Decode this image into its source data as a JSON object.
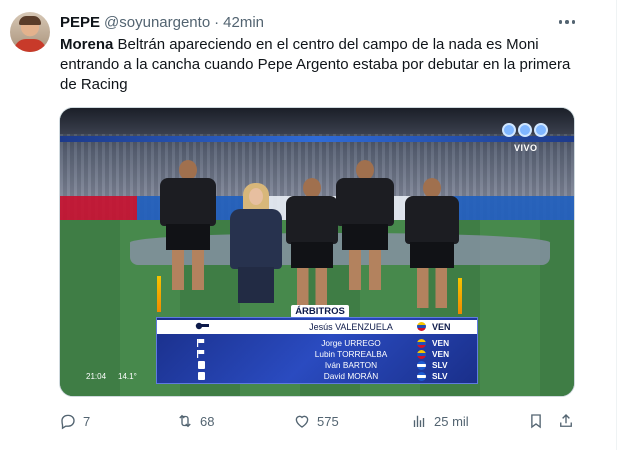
{
  "tweet": {
    "author_name": "PEPE",
    "handle": "@soyunargento",
    "separator": "·",
    "time": "42min",
    "text_lead": "Morena",
    "text_rest": " Beltrán apareciendo en el centro del campo de la nada es Moni entrando a la cancha cuando Pepe Argento estaba por debutar en la primera de Racing"
  },
  "media": {
    "live_badge": "VIVO",
    "graphic_title": "ÁRBITROS",
    "referees": [
      {
        "name": "Jesús VALENZUELA",
        "country": "VEN",
        "flag": "venezuela-flag",
        "role_icon": "whistle-icon"
      },
      {
        "name": "Jorge URREGO",
        "country": "VEN",
        "flag": "venezuela-flag",
        "role_icon": "assistant-flag-icon"
      },
      {
        "name": "Lubin TORREALBA",
        "country": "VEN",
        "flag": "venezuela-flag",
        "role_icon": "assistant-flag-icon"
      },
      {
        "name": "Iván BARTON",
        "country": "SLV",
        "flag": "el-salvador-flag",
        "role_icon": "fourth-official-icon"
      },
      {
        "name": "David MORÁN",
        "country": "SLV",
        "flag": "el-salvador-flag",
        "role_icon": "fourth-official-icon"
      }
    ],
    "clock": "21:04",
    "temperature": "14.1°"
  },
  "actions": {
    "replies": "7",
    "retweets": "68",
    "likes": "575",
    "views": "25 mil"
  },
  "colors": {
    "text": "#0f1419",
    "muted": "#536471",
    "graphic_blue": "#2a4bc0"
  }
}
